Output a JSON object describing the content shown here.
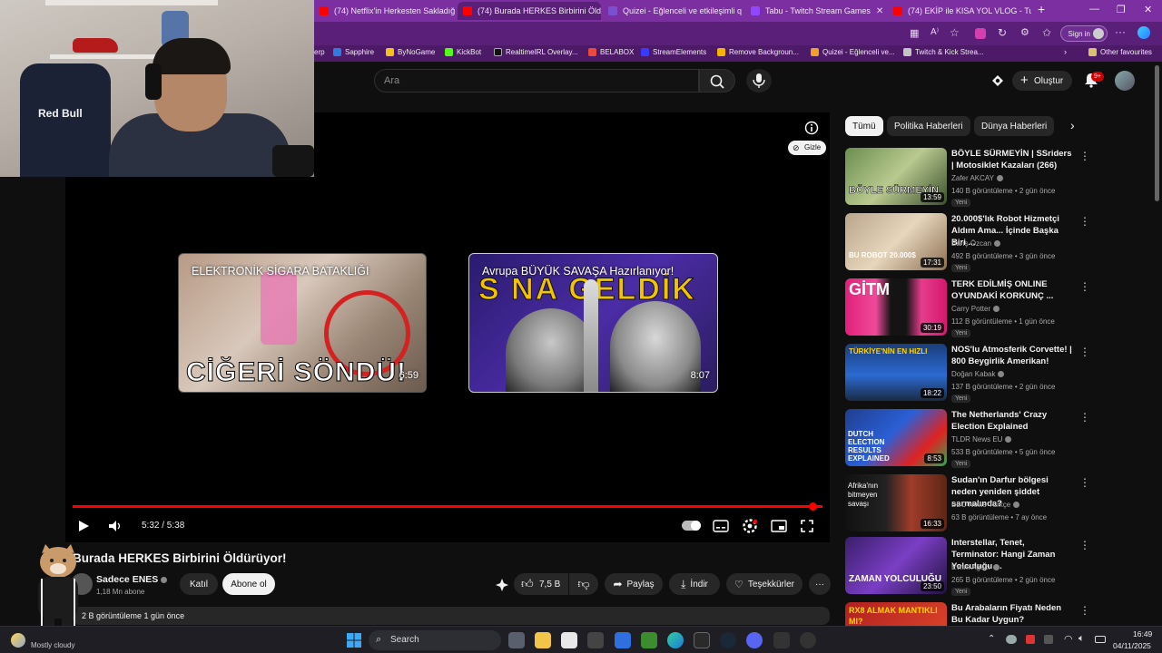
{
  "browser": {
    "tabs": [
      {
        "label": "(74) Netflix'in Herkesten Sakladığı",
        "color": "#ff0000"
      },
      {
        "label": "(74) Burada HERKES Birbirini Öldü",
        "color": "#ff0000",
        "active": true
      },
      {
        "label": "Quizei - Eğlenceli ve etkileşimli q",
        "color": "#7a4fd0"
      },
      {
        "label": "Tabu - Twitch Stream Games",
        "color": "#9146ff"
      },
      {
        "label": "(74) EKİP ile KISA YOL VLOG - Tu",
        "color": "#ff0000"
      }
    ],
    "sign_in": "Sign in",
    "bookmarks": [
      "erp",
      "Sapphire",
      "ByNoGame",
      "KickBot",
      "RealtimeIRL Overlay...",
      "BELABOX",
      "StreamElements",
      "Remove Backgroun...",
      "Quizei - Eğlenceli ve...",
      "Twitch & Kick Strea..."
    ],
    "other_favourites": "Other favourites"
  },
  "webcam": {
    "jersey_text": "Red Bull"
  },
  "header": {
    "search_placeholder": "Ara",
    "create_label": "Oluştur",
    "notifications": "9+"
  },
  "player": {
    "hide_label": "Gizle",
    "time": "5:32 / 5:38",
    "progress": 0.982,
    "endcards": [
      {
        "title": "ELEKTRONİK SİGARA BATAKLIĞI",
        "thumb_text": "CİĞERİ SÖNDÜ!",
        "duration": "6:59"
      },
      {
        "title": "Avrupa BÜYÜK SAVAŞA Hazırlanıyor!",
        "thumb_text": "S NA GELDİK",
        "duration": "8:07"
      }
    ]
  },
  "video": {
    "title": "Burada HERKES Birbirini Öldürüyor!",
    "channel": "Sadece ENES",
    "subscribers": "1,18 Mn abone",
    "join_label": "Katıl",
    "subscribe_label": "Abone ol",
    "likes": "7,5 B",
    "share_label": "Paylaş",
    "download_label": "İndir",
    "thanks_label": "Teşekkürler",
    "views_line": "2 B görüntüleme  1 gün önce"
  },
  "sidebar": {
    "chips": [
      "Tümü",
      "Politika Haberleri",
      "Dünya Haberleri"
    ],
    "recs": [
      {
        "title": "BÖYLE SÜRMEYİN | SSriders | Motosiklet Kazaları (266)",
        "channel": "Zafer AKCAY",
        "meta": "140 B görüntüleme • 2 gün önce",
        "duration": "13:59",
        "new": "Yeni",
        "thumb_text": "BÖYLE SÜRMEYİN"
      },
      {
        "title": "20.000$'lık Robot Hizmetçi Aldım Ama... İçinde Başka Biri ...",
        "channel": "Barış Özcan",
        "meta": "492 B görüntüleme • 3 gün önce",
        "duration": "17:31",
        "new": "Yeni",
        "thumb_text": "BU ROBOT 20.000$"
      },
      {
        "title": "TERK EDİLMİŞ ONLINE OYUNDAKİ KORKUNÇ ...",
        "channel": "Carry Potter",
        "meta": "112 B görüntüleme • 1 gün önce",
        "duration": "30:19",
        "new": "Yeni",
        "thumb_text": "GİTM"
      },
      {
        "title": "NOS'lu Atmosferik Corvette! | 800 Beygirlik Amerikan!",
        "channel": "Doğan Kabak",
        "meta": "137 B görüntüleme • 2 gün önce",
        "duration": "18:22",
        "new": "Yeni",
        "thumb_text": "TÜRKİYE'NİN EN HIZLI"
      },
      {
        "title": "The Netherlands' Crazy Election Explained",
        "channel": "TLDR News EU",
        "meta": "533 B görüntüleme • 5 gün önce",
        "duration": "8:53",
        "new": "Yeni",
        "thumb_text": "DUTCH ELECTION RESULTS EXPLAINED"
      },
      {
        "title": "Sudan'ın Darfur bölgesi neden yeniden şiddet sarmalında?",
        "channel": "BBC News Türkçe",
        "meta": "63 B görüntüleme • 7 ay önce",
        "duration": "16:33",
        "new": "",
        "thumb_text": "Afrika'nın bitmeyen savaşı"
      },
      {
        "title": "Interstellar, Tenet, Terminator: Hangi Zaman Yolculuğu ...",
        "channel": "Evrim Ağacı",
        "meta": "265 B görüntüleme • 2 gün önce",
        "duration": "23:50",
        "new": "Yeni",
        "thumb_text": "ZAMAN YOLCULUĞU"
      },
      {
        "title": "Bu Arabaların Fiyatı Neden Bu Kadar Uygun?",
        "channel": "",
        "meta": "",
        "duration": "",
        "new": "",
        "thumb_text": "RX8 ALMAK MANTIKLI MI?"
      }
    ]
  },
  "taskbar": {
    "weather": "Mostly cloudy",
    "search_label": "Search",
    "time": "16:49",
    "date": "04/11/2025"
  },
  "colors": {
    "accent": "#ff0000",
    "browser": "#7b2fa0",
    "background": "#0f0f0f"
  }
}
